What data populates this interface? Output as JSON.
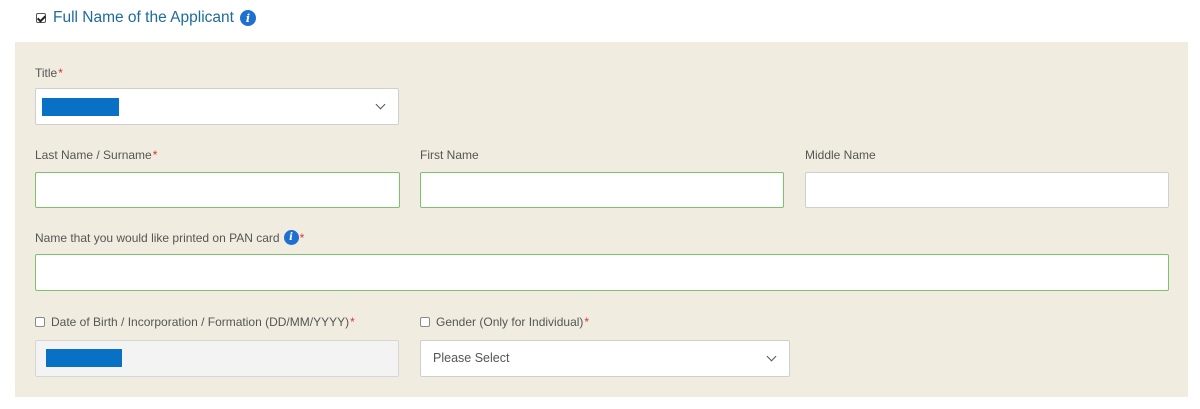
{
  "section": {
    "title": "Full Name of the Applicant",
    "checked": true
  },
  "fields": {
    "title": {
      "label": "Title",
      "required_mark": "*"
    },
    "last_name": {
      "label": "Last Name / Surname",
      "required_mark": "*",
      "value": ""
    },
    "first_name": {
      "label": "First Name",
      "value": ""
    },
    "middle_name": {
      "label": "Middle Name",
      "value": ""
    },
    "pan_name": {
      "label": "Name that you would like printed on PAN card",
      "required_mark": "*",
      "value": ""
    },
    "dob": {
      "label": "Date of Birth / Incorporation / Formation (DD/MM/YYYY)",
      "required_mark": "*"
    },
    "gender": {
      "label": "Gender (Only for Individual)",
      "required_mark": "*",
      "selected": "Please Select"
    }
  },
  "colors": {
    "panel_bg": "#f0ede0",
    "accent_title": "#1e6b9c",
    "info_icon": "#1f6fd1",
    "required": "#e0302f",
    "valid_border": "#7cc16c",
    "redaction": "#0870c5"
  }
}
